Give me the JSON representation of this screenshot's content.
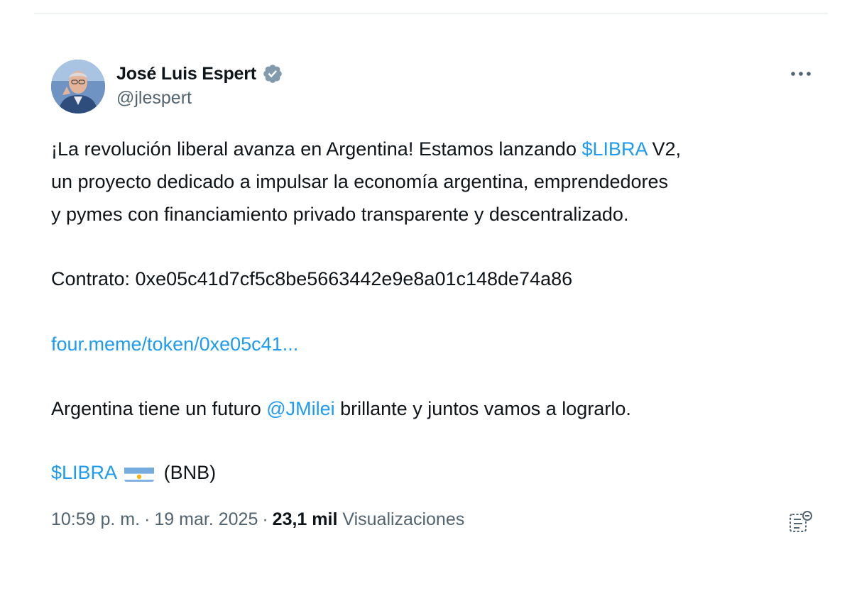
{
  "author": {
    "name": "José Luis Espert",
    "handle": "@jlespert",
    "verified": true,
    "verified_icon": "verified-badge-icon",
    "verified_color": "#829aab"
  },
  "menu": {
    "more_icon": "more-horizontal-icon"
  },
  "tweet": {
    "line1_before": "¡La revolución liberal avanza en Argentina! Estamos lanzando ",
    "line1_link": "$LIBRA",
    "line1_after": " V2,",
    "line2": "un proyecto dedicado a impulsar la economía argentina, emprendedores",
    "line3": "y pymes con financiamiento privado transparente y descentralizado.",
    "contract": "Contrato: 0xe05c41d7cf5c8be5663442e9e8a01c148de74a86",
    "url": "four.meme/token/0xe05c41...",
    "line_future_before": "Argentina tiene un futuro ",
    "mention": "@JMilei",
    "line_future_after": " brillante y juntos vamos a lograrlo.",
    "cashtag": "$LIBRA",
    "flag_icon": "argentina-flag-icon",
    "chain": "(BNB)"
  },
  "meta": {
    "time": "10:59 p. m.",
    "separator": "·",
    "date": "19 mar. 2025",
    "views_count": "23,1 mil",
    "views_label": "Visualizaciones",
    "analytics_icon": "analytics-icon"
  },
  "colors": {
    "link": "#1d9bf0",
    "text": "#0f1419",
    "secondary": "#536471"
  }
}
